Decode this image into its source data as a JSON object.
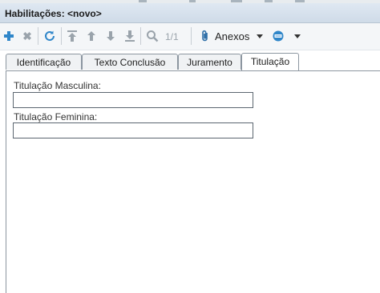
{
  "window": {
    "title": "Habilitações: <novo>"
  },
  "toolbar": {
    "counter": "1/1",
    "anexos_label": "Anexos",
    "icons": [
      "add-icon",
      "delete-icon",
      "refresh-icon",
      "move-first-icon",
      "move-up-icon",
      "move-down-icon",
      "move-last-icon",
      "search-icon",
      "paperclip-icon",
      "options-icon"
    ]
  },
  "tabs": [
    {
      "label": "Identificação",
      "active": false
    },
    {
      "label": "Texto Conclusão",
      "active": false
    },
    {
      "label": "Juramento",
      "active": false
    },
    {
      "label": "Titulação",
      "active": true
    }
  ],
  "form": {
    "masculina": {
      "label": "Titulação Masculina:",
      "value": ""
    },
    "feminina": {
      "label": "Titulação Feminina:",
      "value": ""
    }
  }
}
